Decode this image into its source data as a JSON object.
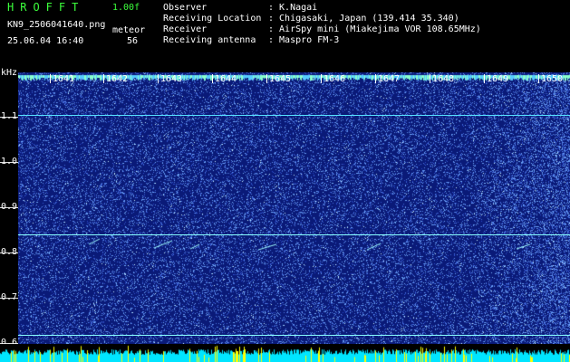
{
  "header": {
    "logo": "HROFFT",
    "version": "1.00f",
    "filename": "KN9_2506041640.png",
    "datetime": "25.06.04 16:40",
    "meteor_label": "meteor",
    "meteor_count": "56",
    "info": [
      {
        "label": "Observer",
        "value": ": K.Nagai"
      },
      {
        "label": "Receiving Location",
        "value": ": Chigasaki, Japan (139.414 35.340)"
      },
      {
        "label": "Receiver",
        "value": ": AirSpy mini (Miakejima VOR 108.65MHz)"
      },
      {
        "label": "Receiving antenna",
        "value": ": Maspro FM-3"
      }
    ]
  },
  "y_axis": {
    "unit": "kHz",
    "labels": [
      "1.1",
      "1.0",
      "0.9",
      "0.8",
      "0.7",
      "0.6"
    ]
  },
  "x_axis": {
    "labels": [
      "1641",
      "1642",
      "1643",
      "1644",
      "1645",
      "1646",
      "1647",
      "1648",
      "1649",
      "1650"
    ]
  },
  "colors": {
    "background": "#0a1a78",
    "noise": "#4a6cff",
    "line": "#66ffff",
    "activity": "#ffff00",
    "base": "#00e5ff"
  }
}
